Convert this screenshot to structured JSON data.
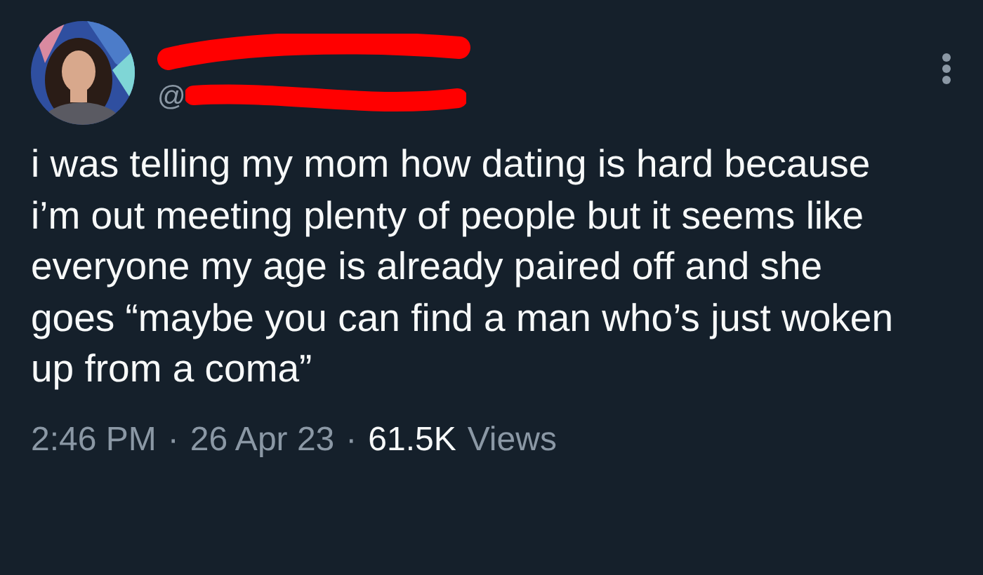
{
  "tweet": {
    "handle": "@",
    "redacted": true,
    "text": "i was telling my mom how dating is hard because i’m out meeting plenty of people but it seems like everyone my age is already paired off and she goes “maybe you can find a man who’s just woken up from a coma”",
    "meta": [
      {
        "kind": "muted",
        "text": "2:46 PM"
      },
      {
        "kind": "sep",
        "text": "·"
      },
      {
        "kind": "muted",
        "text": "26 Apr 23"
      },
      {
        "kind": "sep",
        "text": "·"
      },
      {
        "kind": "strong",
        "text": "61.5K"
      },
      {
        "kind": "muted",
        "text": "Views"
      }
    ]
  }
}
